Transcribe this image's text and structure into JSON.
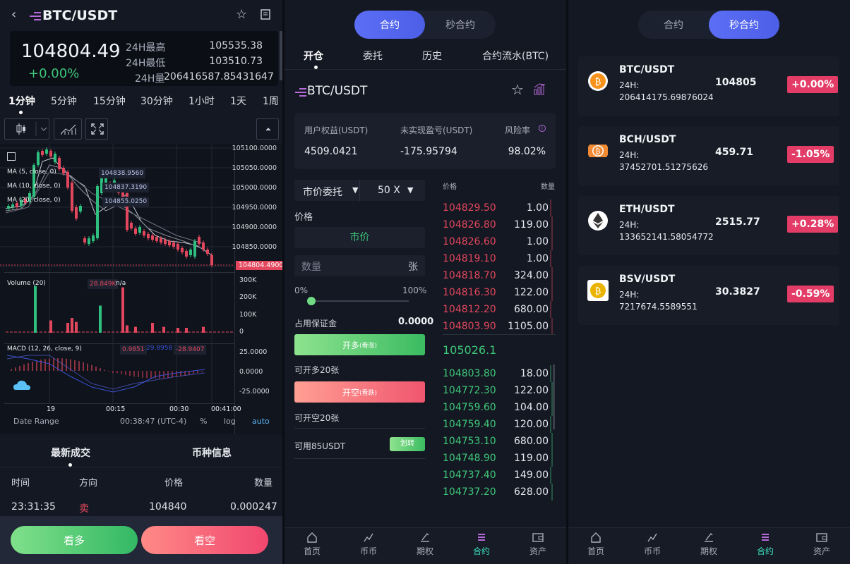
{
  "p1": {
    "title": "BTC/USDT",
    "price": "104804.49",
    "change": "+0.00%",
    "high_label": "24H最高",
    "high": "105535.38",
    "low_label": "24H最低",
    "low": "103510.73",
    "vol_label": "24H量",
    "vol": "206416587.85431647",
    "timeframes": [
      "1分钟",
      "5分钟",
      "15分钟",
      "30分钟",
      "1小时",
      "1天",
      "1周"
    ],
    "chart": {
      "y_ticks": [
        "105100.0000",
        "105050.0000",
        "105000.0000",
        "104950.0000",
        "104900.0000",
        "104850.0000"
      ],
      "last_price": "104804.4900",
      "ma5": "MA (5, close, 0)",
      "ma10": "MA (10, close, 0)",
      "ma20": "MA (20, close, 0)",
      "ma5_val": "104838.9560",
      "ma10_val": "104837.3190",
      "ma20_val": "104855.0250",
      "vol_label": "Volume (20)",
      "vol_val": "28.849K",
      "vol_na": "n/a",
      "vol_ticks": [
        "300K",
        "200K",
        "100K",
        "0"
      ],
      "macd_label": "MACD (12, 26, close, 9)",
      "macd_v1": "0.9851",
      "macd_v2": "29.8958",
      "macd_v3": "-28.9407",
      "macd_ticks": [
        "25.0000",
        "0.0000",
        "-25.0000"
      ],
      "x_ticks": [
        "19",
        "00:15",
        "00:30",
        "00:41:00"
      ],
      "date_range": "Date Range",
      "time": "00:38:47 (UTC-4)",
      "pct": "%",
      "log": "log",
      "auto": "auto"
    },
    "tab_latest": "最新成交",
    "tab_info": "币种信息",
    "cols": [
      "时间",
      "方向",
      "价格",
      "数量"
    ],
    "row": {
      "time": "23:31:35",
      "dir": "卖",
      "price": "104840",
      "qty": "0.000247"
    },
    "buy": "看多",
    "sell": "看空"
  },
  "p2": {
    "seg": [
      "合约",
      "秒合约"
    ],
    "tabs": [
      "开仓",
      "委托",
      "历史",
      "合约流水(BTC)"
    ],
    "title": "BTC/USDT",
    "card": {
      "l1": "用户权益(USDT)",
      "v1": "4509.0421",
      "l2": "未实现盈亏(USDT)",
      "v2": "-175.95794",
      "l3": "风险率",
      "v3": "98.02%"
    },
    "order_type": "市价委托",
    "leverage": "50 X",
    "price_label": "价格",
    "market": "市价",
    "qty_ph": "数量",
    "unit": "张",
    "pct_min": "0%",
    "pct_max": "100%",
    "margin_label": "占用保证金",
    "margin": "0.0000",
    "long_btn": "开多",
    "long_sub": "(看涨)",
    "can_long": "可开多20张",
    "short_btn": "开空",
    "short_sub": "(看跌)",
    "can_short": "可开空20张",
    "avail": "可用85USDT",
    "transfer": "划转",
    "ob_price": "价格",
    "ob_qty": "数量",
    "asks": [
      [
        "104829.50",
        "1.00"
      ],
      [
        "104826.80",
        "119.00"
      ],
      [
        "104826.60",
        "1.00"
      ],
      [
        "104819.10",
        "1.00"
      ],
      [
        "104818.70",
        "324.00"
      ],
      [
        "104816.30",
        "122.00"
      ],
      [
        "104812.20",
        "680.00"
      ],
      [
        "104803.90",
        "1105.00"
      ]
    ],
    "mid": "105026.1",
    "bids": [
      [
        "104803.80",
        "18.00"
      ],
      [
        "104772.30",
        "122.00"
      ],
      [
        "104759.60",
        "104.00"
      ],
      [
        "104759.40",
        "120.00"
      ],
      [
        "104753.10",
        "680.00"
      ],
      [
        "104748.90",
        "119.00"
      ],
      [
        "104737.40",
        "149.00"
      ],
      [
        "104737.20",
        "628.00"
      ]
    ]
  },
  "nav": [
    "首页",
    "币币",
    "期权",
    "合约",
    "资产"
  ],
  "p3": {
    "seg": [
      "合约",
      "秒合约"
    ],
    "coins": [
      {
        "name": "BTC/USDT",
        "vol_label": "24H:",
        "vol": "206414175.69876024",
        "price": "104805",
        "change": "+0.00%"
      },
      {
        "name": "BCH/USDT",
        "vol_label": "24H:",
        "vol": "37452701.51275626",
        "price": "459.71",
        "change": "-1.05%"
      },
      {
        "name": "ETH/USDT",
        "vol_label": "24H:",
        "vol": "133652141.58054772",
        "price": "2515.77",
        "change": "+0.28%"
      },
      {
        "name": "BSV/USDT",
        "vol_label": "24H:",
        "vol": "7217674.5589551",
        "price": "30.3827",
        "change": "-0.59%"
      }
    ]
  }
}
